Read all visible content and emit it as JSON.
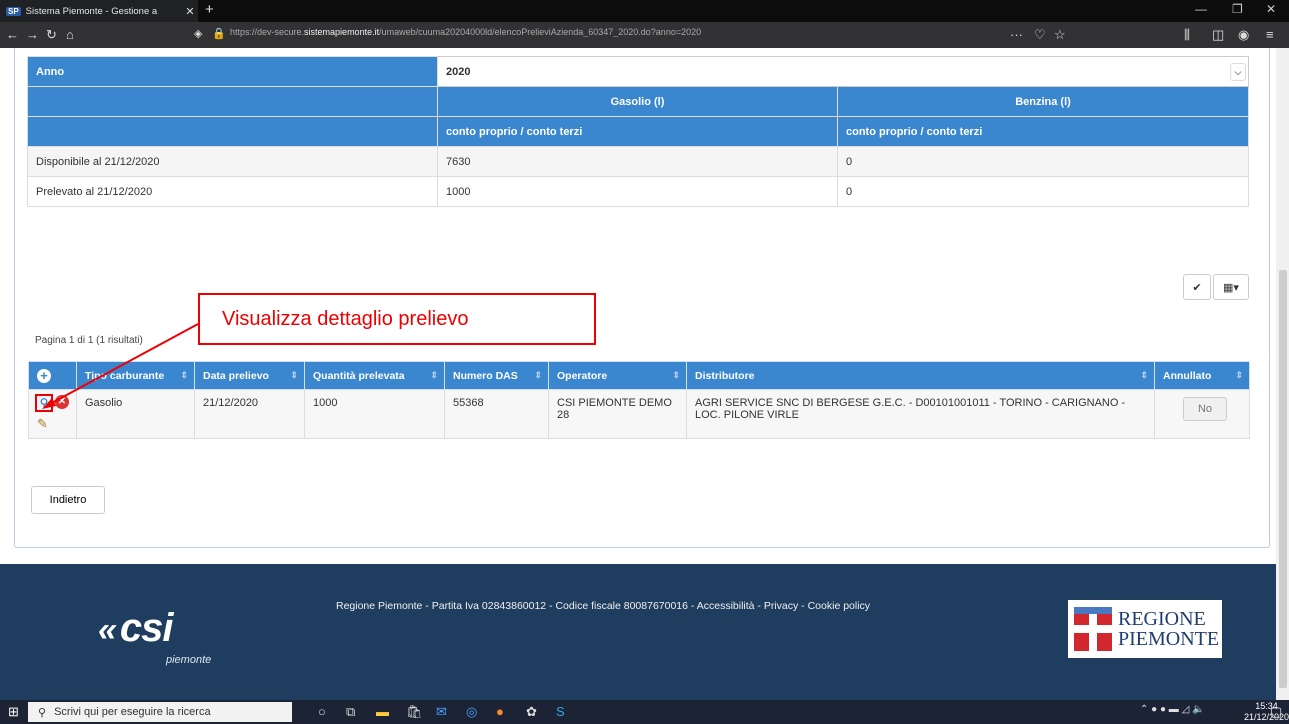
{
  "browser": {
    "tab_title": "Sistema Piemonte - Gestione a",
    "url_prefix": "https://dev-secure.",
    "url_domain": "sistemapiemonte.it",
    "url_path": "/umaweb/cuuma20204000ld/elencoPrelieviAzienda_60347_2020.do?anno=2020"
  },
  "summary": {
    "anno_label": "Anno",
    "anno_value": "2020",
    "gasolio_header": "Gasolio (l)",
    "benzina_header": "Benzina (l)",
    "gasolio_sub": "conto proprio / conto terzi",
    "benzina_sub": "conto proprio / conto terzi",
    "rows": [
      {
        "label": "Disponibile al 21/12/2020",
        "gasolio": "7630",
        "benzina": "0"
      },
      {
        "label": "Prelevato al 21/12/2020",
        "gasolio": "1000",
        "benzina": "0"
      }
    ]
  },
  "results": {
    "pagination": "Pagina 1 di 1 (1 risultati)",
    "headers": {
      "tipo": "Tipo carburante",
      "data": "Data prelievo",
      "quantita": "Quantità prelevata",
      "das": "Numero DAS",
      "operatore": "Operatore",
      "distributore": "Distributore",
      "annullato": "Annullato"
    },
    "rows": [
      {
        "tipo": "Gasolio",
        "data": "21/12/2020",
        "quantita": "1000",
        "das": "55368",
        "operatore": "CSI PIEMONTE DEMO 28",
        "distributore": "AGRI SERVICE SNC DI BERGESE G.E.C. - D00101001011 - TORINO - CARIGNANO - LOC. PILONE VIRLE",
        "annullato": "No"
      }
    ]
  },
  "back_label": "Indietro",
  "callout": "Visualizza dettaglio prelievo",
  "footer": {
    "links": "Regione Piemonte - Partita Iva 02843860012 - Codice fiscale 80087670016 - Accessibilità - Privacy - Cookie policy",
    "csi_logo": "csi",
    "csi_sub": "piemonte",
    "regione_line1": "REGIONE",
    "regione_line2": "PIEMONTE"
  },
  "taskbar": {
    "search_placeholder": "Scrivi qui per eseguire la ricerca",
    "time": "15:34",
    "date": "21/12/2020"
  },
  "colors": {
    "header_blue": "#3a86cf",
    "footer": "#1f3d5f",
    "callout": "#e00000"
  }
}
